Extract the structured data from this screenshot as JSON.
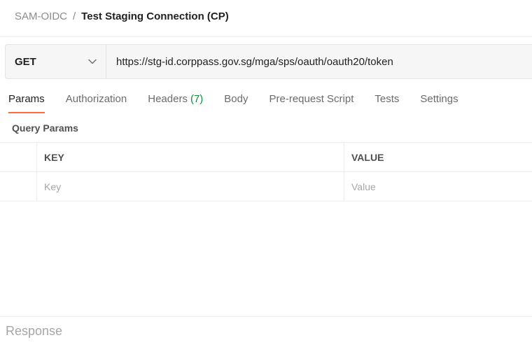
{
  "breadcrumb": {
    "collection": "SAM-OIDC",
    "separator": "/",
    "request_name": "Test Staging Connection (CP)"
  },
  "request": {
    "method": "GET",
    "url": "https://stg-id.corppass.gov.sg/mga/sps/oauth/oauth20/token"
  },
  "tabs": [
    {
      "label": "Params",
      "active": true
    },
    {
      "label": "Authorization"
    },
    {
      "label": "Headers",
      "count": "(7)"
    },
    {
      "label": "Body"
    },
    {
      "label": "Pre-request Script"
    },
    {
      "label": "Tests"
    },
    {
      "label": "Settings"
    }
  ],
  "query_params": {
    "title": "Query Params",
    "columns": {
      "key": "KEY",
      "value": "VALUE"
    },
    "new_row": {
      "key_placeholder": "Key",
      "value_placeholder": "Value"
    }
  },
  "response": {
    "label": "Response"
  },
  "colors": {
    "accent": "#ff6c37",
    "count_green": "#0f8a3c"
  }
}
